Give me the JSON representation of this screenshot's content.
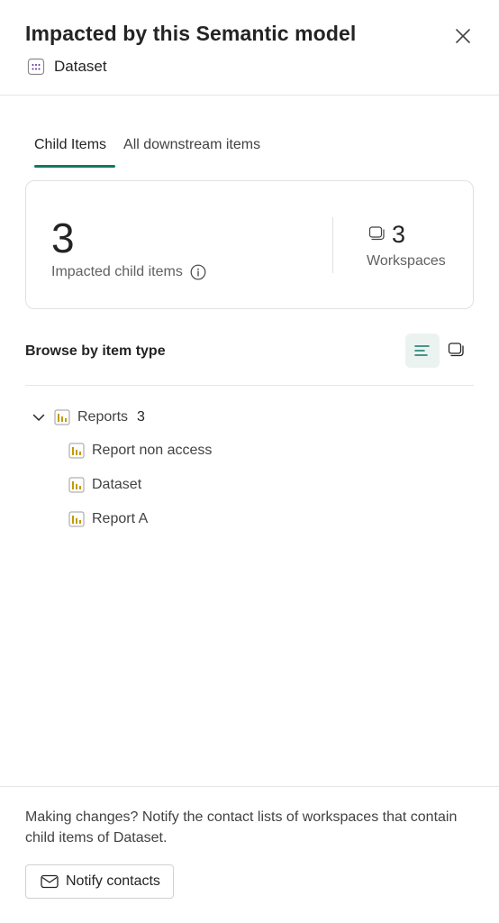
{
  "header": {
    "title": "Impacted by this Semantic model",
    "subtitle": "Dataset",
    "subtitle_icon": "semantic-model-icon",
    "close_icon": "close-icon"
  },
  "tabs": [
    {
      "label": "Child Items",
      "active": true
    },
    {
      "label": "All downstream items",
      "active": false
    }
  ],
  "summary": {
    "impacted_count": "3",
    "impacted_label": "Impacted child items",
    "workspaces_count": "3",
    "workspaces_label": "Workspaces"
  },
  "browse": {
    "label": "Browse by item type",
    "views": [
      {
        "icon": "list-view-icon",
        "selected": true
      },
      {
        "icon": "workspace-view-icon",
        "selected": false
      }
    ]
  },
  "tree": {
    "group": {
      "label": "Reports",
      "count": "3",
      "expanded": true,
      "icon": "report-icon"
    },
    "items": [
      {
        "label": "Report non access",
        "icon": "report-icon"
      },
      {
        "label": "Dataset",
        "icon": "report-icon"
      },
      {
        "label": "Report A",
        "icon": "report-icon"
      }
    ]
  },
  "footer": {
    "text": "Making changes? Notify the contact lists of workspaces that contain child items of Dataset.",
    "button_label": "Notify contacts",
    "button_icon": "mail-icon"
  },
  "colors": {
    "accent": "#117865",
    "report_icon": "#c19c00",
    "selected_view_bg": "#ebf3f1"
  }
}
